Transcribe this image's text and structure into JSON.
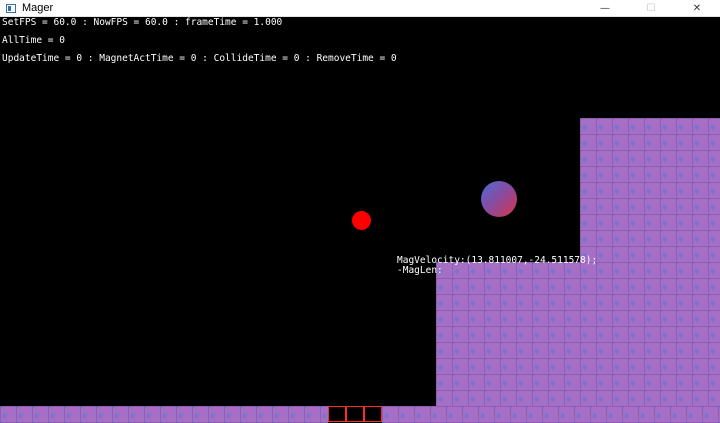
{
  "window": {
    "title": "Mager",
    "icon": "app-window-icon",
    "controls": {
      "minimize": "—",
      "maximize": "☐",
      "close": "✕"
    }
  },
  "debug": {
    "line1": "SetFPS = 60.0 : NowFPS = 60.0 : frameTime = 1.000",
    "line2": "AllTime = 0",
    "line3": "UpdateTime = 0 : MagnetActTime = 0 : CollideTime = 0 : RemoveTime = 0"
  },
  "magnet_info": {
    "velocity": "MagVelocity:(13.811007,-24.511578);",
    "length": "-MagLen:"
  },
  "colors": {
    "background": "#000000",
    "tile": "#a56fc6",
    "player": "#ff0000",
    "goal_border": "#ff2a2a",
    "magnet_gradient": [
      "#4a6bd8",
      "#d8344a"
    ]
  }
}
